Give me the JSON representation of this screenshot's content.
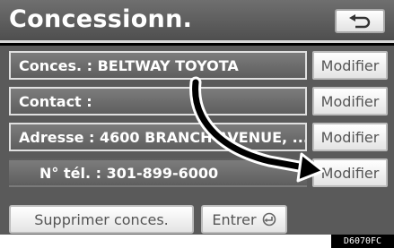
{
  "header": {
    "title": "Concessionn.",
    "back_icon": "return-arrow-icon"
  },
  "fields": [
    {
      "label": "Conces. : BELTWAY TOYOTA",
      "button": "Modifier"
    },
    {
      "label": "Contact :",
      "button": "Modifier"
    },
    {
      "label": "Adresse : 4600 BRANCH AVENUE, ...",
      "button": "Modifier"
    },
    {
      "label": "N° tél. : 301-899-6000",
      "button": "Modifier"
    }
  ],
  "footer": {
    "delete_label": "Supprimer conces.",
    "enter_label": "Entrer",
    "enter_icon": "enter-return-icon"
  },
  "figure_code": "D6070FC",
  "colors": {
    "title_bar": "#5f5f5f",
    "background": "#5a5a5a",
    "button_face": "#f0f0f0"
  }
}
